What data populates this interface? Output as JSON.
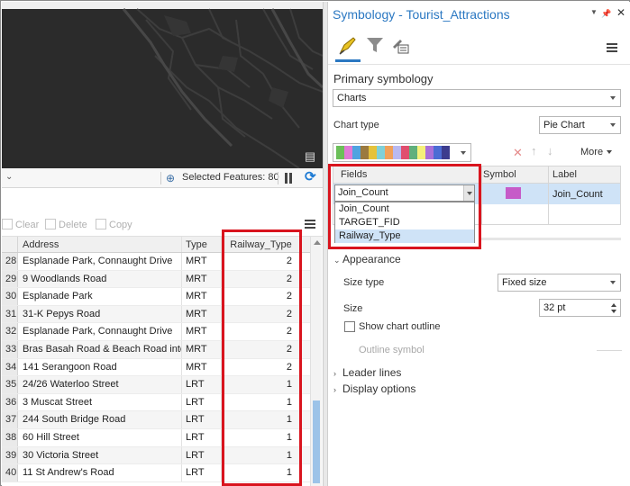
{
  "status": {
    "selected_features": "Selected Features: 80"
  },
  "table": {
    "toolbar": {
      "clear": "Clear",
      "delete": "Delete",
      "copy": "Copy"
    },
    "columns": [
      "Address",
      "Type",
      "Railway_Type"
    ],
    "rows": [
      {
        "oid": "28",
        "address": "Esplanade Park, Connaught Drive",
        "type": "MRT",
        "railway_type": "2"
      },
      {
        "oid": "29",
        "address": "9 Woodlands Road",
        "type": "MRT",
        "railway_type": "2"
      },
      {
        "oid": "30",
        "address": "Esplanade Park",
        "type": "MRT",
        "railway_type": "2"
      },
      {
        "oid": "31",
        "address": "31-K Pepys Road",
        "type": "MRT",
        "railway_type": "2"
      },
      {
        "oid": "32",
        "address": "Esplanade Park, Connaught Drive",
        "type": "MRT",
        "railway_type": "2"
      },
      {
        "oid": "33",
        "address": "Bras Basah Road & Beach Road inte...",
        "type": "MRT",
        "railway_type": "2"
      },
      {
        "oid": "34",
        "address": "141 Serangoon Road",
        "type": "MRT",
        "railway_type": "2"
      },
      {
        "oid": "35",
        "address": "24/26 Waterloo Street",
        "type": "LRT",
        "railway_type": "1"
      },
      {
        "oid": "36",
        "address": "3 Muscat Street",
        "type": "LRT",
        "railway_type": "1"
      },
      {
        "oid": "37",
        "address": "244 South Bridge Road",
        "type": "LRT",
        "railway_type": "1"
      },
      {
        "oid": "38",
        "address": "60 Hill Street",
        "type": "LRT",
        "railway_type": "1"
      },
      {
        "oid": "39",
        "address": "30 Victoria Street",
        "type": "LRT",
        "railway_type": "1"
      },
      {
        "oid": "40",
        "address": "11 St Andrew's Road",
        "type": "LRT",
        "railway_type": "1"
      }
    ]
  },
  "pane": {
    "title": "Symbology - Tourist_Attractions",
    "primary_label": "Primary symbology",
    "primary_value": "Charts",
    "chart_type_label": "Chart type",
    "chart_type_value": "Pie Chart",
    "palette_colors": [
      "#6bbf59",
      "#e07ad6",
      "#4fa3e0",
      "#9b7a3f",
      "#e5c23a",
      "#7fd0d8",
      "#f0a15a",
      "#b9b9f0",
      "#e04e6e",
      "#60b07c",
      "#f5f07a",
      "#a970d9",
      "#4c6cd4",
      "#3c3c8e"
    ],
    "more_label": "More",
    "fields_header": {
      "fields": "Fields",
      "symbol": "Symbol",
      "label": "Label"
    },
    "field_selected": "Join_Count",
    "field_label": "Join_Count",
    "field_symbol_color": "#c65bc8",
    "field_options": [
      "Join_Count",
      "TARGET_FID",
      "Railway_Type"
    ],
    "appearance_label": "Appearance",
    "size_type_label": "Size type",
    "size_type_value": "Fixed size",
    "size_label": "Size",
    "size_value": "32 pt",
    "show_outline_label": "Show chart outline",
    "outline_symbol_label": "Outline symbol",
    "leader_lines_label": "Leader lines",
    "display_options_label": "Display options"
  }
}
